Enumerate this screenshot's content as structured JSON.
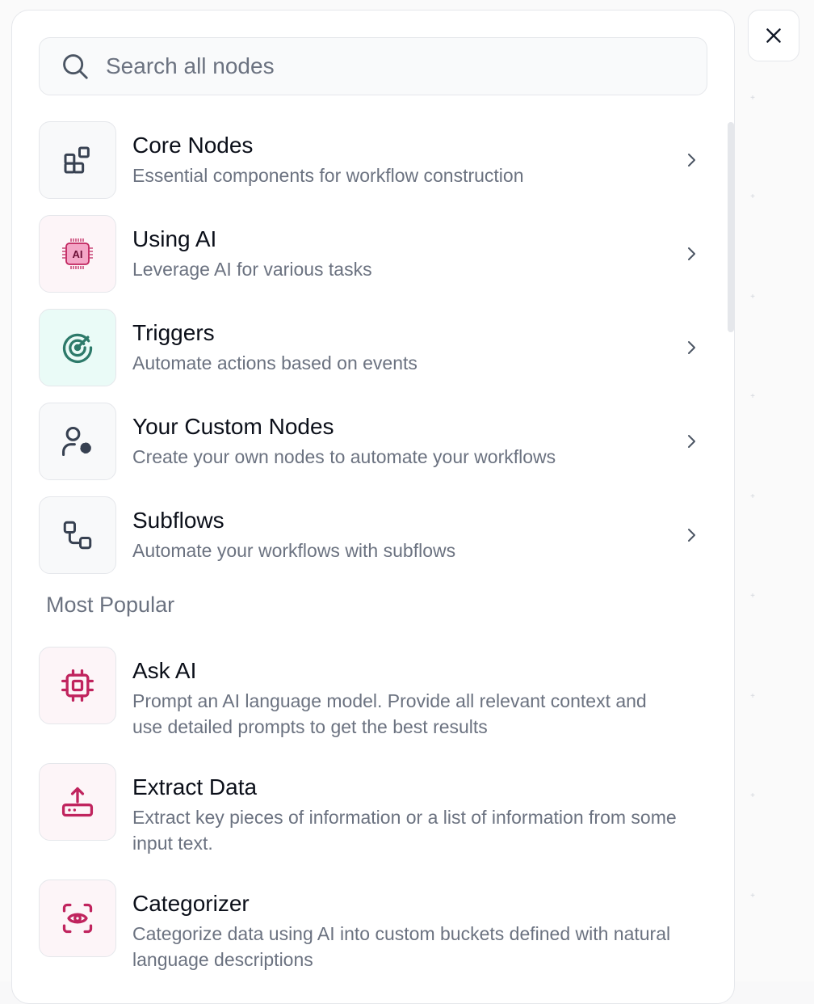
{
  "search": {
    "placeholder": "Search all nodes"
  },
  "categories": [
    {
      "title": "Core Nodes",
      "desc": "Essential components for workflow construction",
      "icon": "grid-blocks-icon"
    },
    {
      "title": "Using AI",
      "desc": "Leverage AI for various tasks",
      "icon": "ai-chip-icon",
      "icon_label": "AI"
    },
    {
      "title": "Triggers",
      "desc": "Automate actions based on events",
      "icon": "radar-icon"
    },
    {
      "title": "Your Custom Nodes",
      "desc": "Create your own nodes to automate your workflows",
      "icon": "user-gear-icon"
    },
    {
      "title": "Subflows",
      "desc": "Automate your workflows with subflows",
      "icon": "subflow-icon"
    }
  ],
  "popular": {
    "heading": "Most Popular",
    "items": [
      {
        "title": "Ask AI",
        "desc": "Prompt an AI language model. Provide all relevant context and use detailed prompts to get the best results",
        "icon": "cpu-icon"
      },
      {
        "title": "Extract Data",
        "desc": "Extract key pieces of information or a list of information from some input text.",
        "icon": "upload-tray-icon"
      },
      {
        "title": "Categorizer",
        "desc": "Categorize data using AI into custom buckets defined with natural language descriptions",
        "icon": "scan-eye-icon"
      }
    ]
  },
  "colors": {
    "ai_pink": "#c0245e",
    "trigger_green": "#2d7a6a",
    "icon_dark": "#374151"
  }
}
